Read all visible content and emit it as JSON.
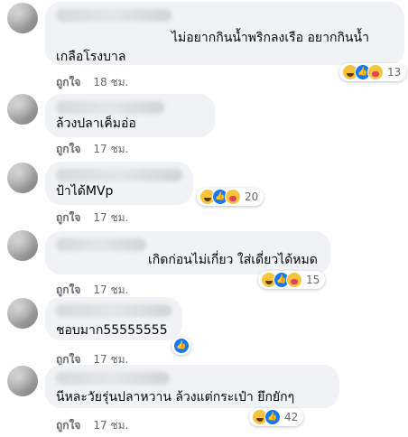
{
  "comments": [
    {
      "text_line1": "ไม่อยากกินน้ำพริกลงเรือ อยากกินน้ำ",
      "text_line2": "เกลือโรงบาล",
      "like": "ถูกใจ",
      "time": "18 ชม.",
      "reaction_count": "13",
      "reactions": [
        "haha-icon",
        "like-icon",
        "care-icon"
      ]
    },
    {
      "text": "ล้วงปลาเค็มอ่อ",
      "like": "ถูกใจ",
      "time": "17 ชม."
    },
    {
      "text": "ป้าได้MVp",
      "like": "ถูกใจ",
      "time": "17 ชม.",
      "reaction_count": "20",
      "reactions": [
        "haha-icon",
        "like-icon",
        "care-icon"
      ]
    },
    {
      "text": "เกิดก่อนไม่เกี่ยว ใส่เดี่ยวได้หมด",
      "like": "ถูกใจ",
      "time": "17 ชม.",
      "reaction_count": "15",
      "reactions": [
        "haha-icon",
        "like-icon",
        "care-icon"
      ]
    },
    {
      "text": "ชอบมาก55555555",
      "like": "ถูกใจ",
      "time": "17 ชม.",
      "reactions": [
        "like-icon"
      ]
    },
    {
      "text": "นีหละวัยรุ่นปลาหวาน ล้วงแต่กระเป๋า ยึกยักๆ",
      "like": "ถูกใจ",
      "time": "17 ชม.",
      "reaction_count": "42",
      "reactions": [
        "haha-icon",
        "like-icon"
      ]
    }
  ],
  "colors": {
    "bubble": "#f0f2f5",
    "meta_text": "#65676b",
    "like_blue": "#1877f2",
    "haha_yellow": "#f7c33d"
  }
}
